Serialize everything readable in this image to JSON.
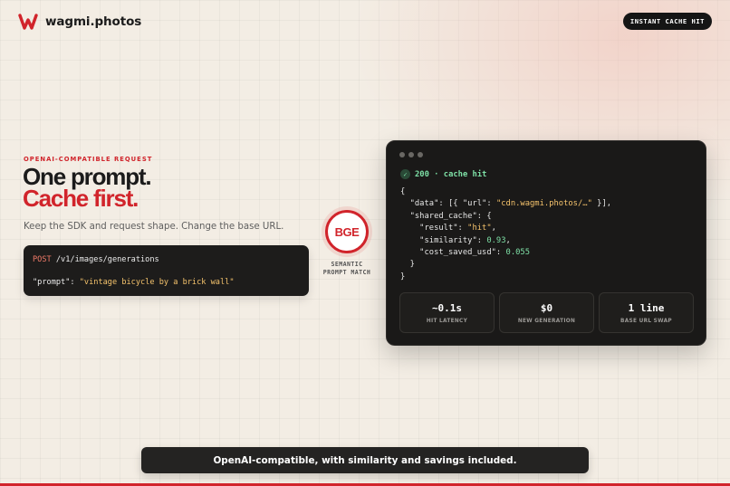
{
  "brand": {
    "name": "wagmi.photos",
    "logo_icon": "wagmi-logo-icon",
    "accent_color": "#d1242b"
  },
  "header": {
    "badge_label": "INSTANT CACHE HIT"
  },
  "hero": {
    "eyebrow": "OPENAI-COMPATIBLE REQUEST",
    "headline_line1": "One prompt.",
    "headline_line2": "Cache first.",
    "subtitle": "Keep the SDK and request shape. Change the base URL."
  },
  "request": {
    "method": "POST",
    "path": " /v1/images/generations",
    "prompt_key": "\"prompt\": ",
    "prompt_value": "\"vintage bicycle by a brick wall\""
  },
  "matcher": {
    "badge": "BGE",
    "caption_line1": "SEMANTIC",
    "caption_line2": "PROMPT MATCH"
  },
  "response": {
    "status_icon": "check-icon",
    "status": "200 · cache hit",
    "code": {
      "l1": "{",
      "l2_a": "  \"data\": [{ \"url\": ",
      "l2_s": "\"cdn.wagmi.photos/…\"",
      "l2_b": " }],",
      "l3": "  \"shared_cache\": {",
      "l4_a": "    \"result\": ",
      "l4_s": "\"hit\"",
      "l4_b": ",",
      "l5_a": "    \"similarity\": ",
      "l5_n": "0.93",
      "l5_b": ",",
      "l6_a": "    \"cost_saved_usd\": ",
      "l6_n": "0.055",
      "l7": "  }",
      "l8": "}"
    },
    "stats": [
      {
        "value": "~0.1s",
        "label": "HIT LATENCY"
      },
      {
        "value": "$0",
        "label": "NEW GENERATION"
      },
      {
        "value": "1 line",
        "label": "BASE URL SWAP"
      }
    ]
  },
  "footer": {
    "message": "OpenAI-compatible, with similarity and savings included."
  }
}
